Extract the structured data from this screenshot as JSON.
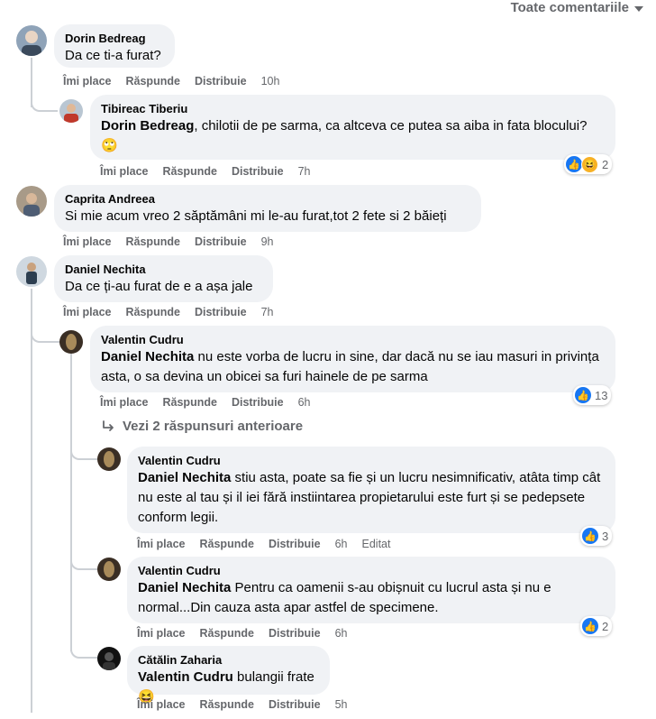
{
  "sort": {
    "label": "Toate comentariile",
    "icon": "caret-down-icon"
  },
  "actions": {
    "like": "Îmi place",
    "reply": "Răspunde",
    "share": "Distribuie",
    "edited": "Editat"
  },
  "more_replies": {
    "label": "Vezi 2 răspunsuri anterioare",
    "icon": "reply-arrow-icon"
  },
  "comments": [
    {
      "author": "Dorin Bedreag",
      "mention": "",
      "text": "Da ce ti-a furat?",
      "time": "10h"
    },
    {
      "author": "Tibireac Tiberiu",
      "mention": "Dorin Bedreag",
      "text": ", chilotii de pe sarma, ca altceva ce putea sa aiba in fata blocului? 🙄",
      "time": "7h",
      "reaction_count": "2"
    },
    {
      "author": "Caprita Andreea",
      "mention": "",
      "text": "Si mie acum vreo 2 săptămâni mi le-au furat,tot 2 fete si 2 băieți",
      "time": "9h"
    },
    {
      "author": "Daniel Nechita",
      "mention": "",
      "text": "Da ce ți-au furat de e a așa jale",
      "time": "7h"
    },
    {
      "author": "Valentin Cudru",
      "mention": "Daniel Nechita",
      "text": " nu este vorba de lucru in sine, dar dacă nu se iau masuri in privința asta, o sa devina un obicei sa furi hainele de pe sarma",
      "time": "6h",
      "reaction_count": "13"
    },
    {
      "author": "Valentin Cudru",
      "mention": "Daniel Nechita",
      "text": " stiu asta, poate sa fie și un lucru nesimnificativ, atâta timp cât nu este al tau și il iei fără instiintarea propietarului este furt și se pedepsete conform legii.",
      "time": "6h",
      "reaction_count": "3",
      "edited": true
    },
    {
      "author": "Valentin Cudru",
      "mention": "Daniel Nechita",
      "text": " Pentru ca oamenii s-au obișnuit cu lucrul asta și nu e normal...Din cauza asta apar astfel de specimene.",
      "time": "6h",
      "reaction_count": "2"
    },
    {
      "author": "Cătălin Zaharia",
      "mention": "Valentin Cudru",
      "text": " bulangii frate 😆",
      "time": "5h"
    }
  ],
  "colors": {
    "like": "#1877f2",
    "haha": "#f7b125",
    "bubble": "#f0f2f5",
    "meta": "#65676b"
  }
}
